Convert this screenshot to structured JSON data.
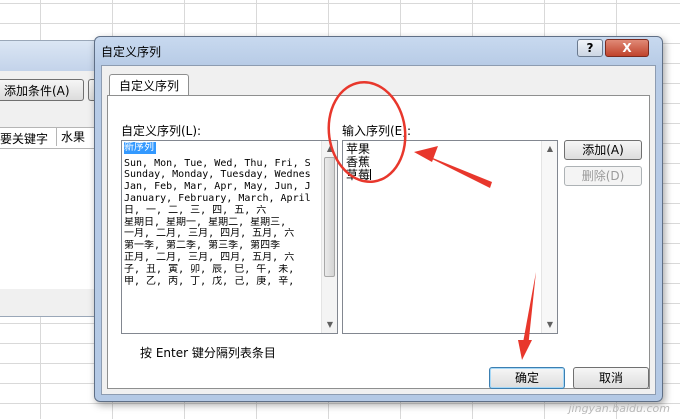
{
  "background_dialog": {
    "add_condition_button": "添加条件(A)",
    "primary_key_label": "要关键字",
    "key_value": "水果"
  },
  "dialog": {
    "title": "自定义序列",
    "help_icon_glyph": "?",
    "close_icon_glyph": "X",
    "tab_label": "自定义序列",
    "custom_lists_label": "自定义序列(L):",
    "list_items": [
      "新序列",
      "Sun, Mon, Tue, Wed, Thu, Fri, S",
      "Sunday, Monday, Tuesday, Wednes",
      "Jan, Feb, Mar, Apr, May, Jun, J",
      "January, February, March, April",
      "日, 一, 二, 三, 四, 五, 六",
      "星期日, 星期一, 星期二, 星期三, ",
      "一月, 二月, 三月, 四月, 五月, 六",
      "第一季, 第二季, 第三季, 第四季",
      "正月, 二月, 三月, 四月, 五月, 六",
      "子, 丑, 寅, 卯, 辰, 巳, 午, 未,",
      "甲, 乙, 丙, 丁, 戊, 己, 庚, 辛,"
    ],
    "selected_index": 0,
    "entries_label": "输入序列(E):",
    "entries": [
      "苹果",
      "香蕉",
      "草莓"
    ],
    "add_button": "添加(A)",
    "delete_button": "删除(D)",
    "hint": "按 Enter 键分隔列表条目",
    "ok_button": "确定",
    "cancel_button": "取消"
  },
  "watermark": "jingyan.baidu.com",
  "colors": {
    "annotation": "#e8372c",
    "selection": "#3399ff"
  }
}
